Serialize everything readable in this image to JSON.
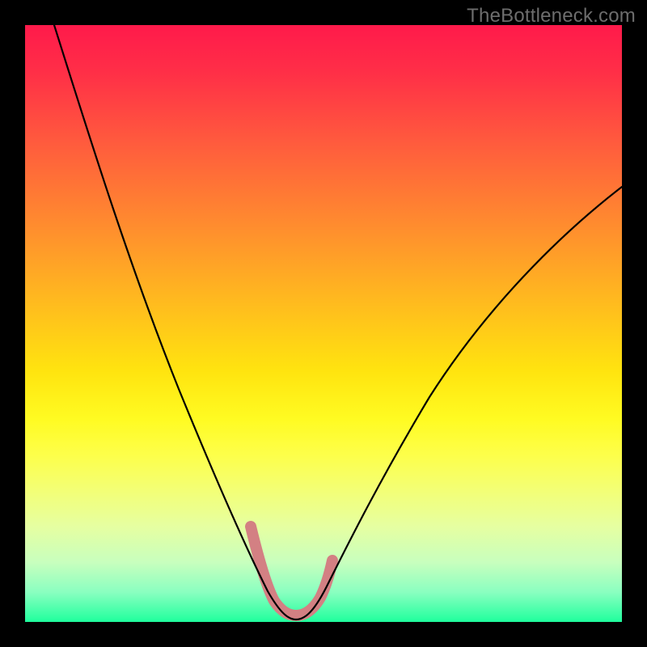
{
  "watermark": {
    "text": "TheBottleneck.com"
  },
  "chart_data": {
    "type": "line",
    "title": "",
    "xlabel": "",
    "ylabel": "",
    "xlim": [
      0,
      100
    ],
    "ylim": [
      0,
      100
    ],
    "series": [
      {
        "name": "bottleneck-curve",
        "x": [
          5,
          10,
          15,
          20,
          25,
          30,
          35,
          38,
          41,
          43,
          45,
          47,
          50,
          55,
          60,
          65,
          70,
          75,
          80,
          85,
          90,
          95,
          100
        ],
        "y": [
          100,
          88,
          76,
          64,
          52,
          40,
          27,
          16,
          7,
          3,
          1.5,
          3,
          8,
          18,
          28,
          37,
          44,
          51,
          57,
          62,
          66,
          70,
          73
        ]
      }
    ],
    "highlight": {
      "name": "bottom-highlight",
      "x_range": [
        38,
        50
      ],
      "color": "#d38083",
      "stroke_width_px": 14
    },
    "gradient_stops": [
      {
        "pos": 0.0,
        "color": "#ff1a4b"
      },
      {
        "pos": 0.2,
        "color": "#ff5c3d"
      },
      {
        "pos": 0.46,
        "color": "#ffb91f"
      },
      {
        "pos": 0.66,
        "color": "#fffb22"
      },
      {
        "pos": 0.9,
        "color": "#c8ffbe"
      },
      {
        "pos": 1.0,
        "color": "#1fff9d"
      }
    ]
  }
}
